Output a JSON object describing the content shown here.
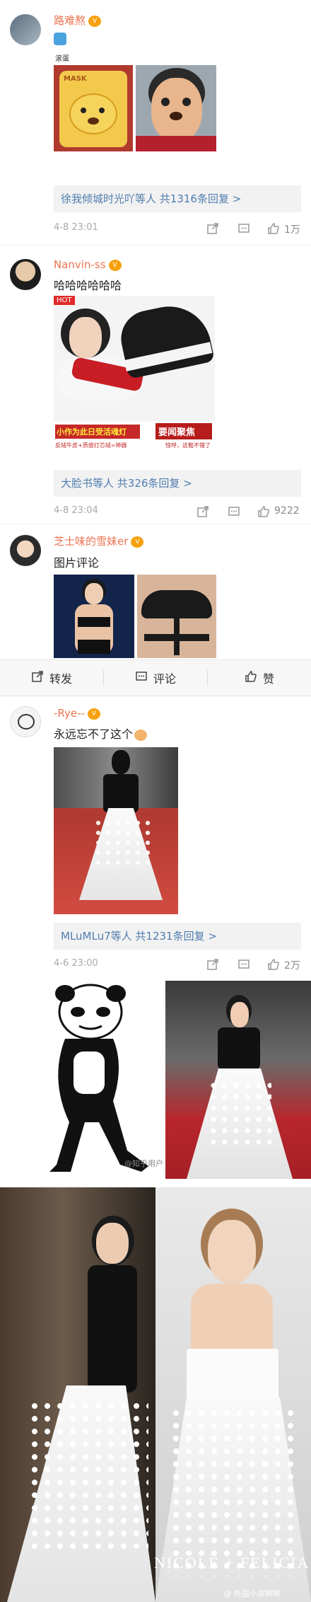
{
  "c1": {
    "user": "路难熬",
    "time": "4-8 23:01",
    "reply_link": "徐我倾城时光吖等人",
    "reply_count": "共1316条回复 >",
    "likes": "1万",
    "img_caption": "滚蛋",
    "mask_text": "MASK"
  },
  "c2": {
    "user": "Nanvin-ss",
    "text": "哈哈哈哈哈哈",
    "time": "4-8 23:04",
    "reply_link": "大脸书等人",
    "reply_count": "共326条回复 >",
    "likes": "9222",
    "ad_text1": "小作为此日受活魂灯",
    "ad_text2": "反绒牛皮+质感灯芯绒=神器",
    "ad_text3": "要闻聚焦",
    "ad_text4": "惊呼，这鞋不错了",
    "ad_tag": "HOT"
  },
  "c3": {
    "user": "芝士味的雪妹er",
    "text": "图片评论"
  },
  "bar": {
    "forward": "转发",
    "comment": "评论",
    "like": "赞"
  },
  "c4": {
    "user": "-Rye--",
    "text": "永远忘不了这个",
    "time": "4-6 23:00",
    "reply_link": "MLuMLu7等人",
    "reply_count": "共1231条回复 >",
    "likes": "2万"
  },
  "meme": {
    "watermark": "@知乎用户"
  },
  "bottom": {
    "brand": "NICOLE + FELICIA",
    "watermark": "@ 外国小孩啊啊"
  },
  "icons": [
    "share-icon",
    "comment-icon",
    "like-icon",
    "forward-icon",
    "thumb-icon"
  ]
}
